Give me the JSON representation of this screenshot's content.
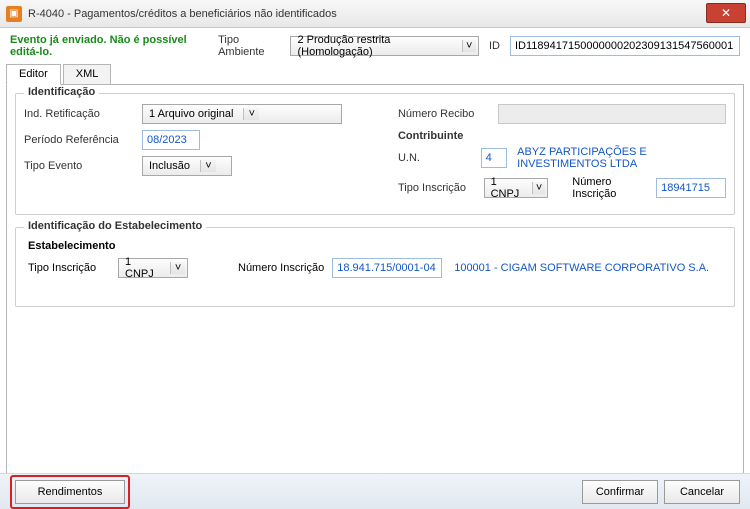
{
  "window": {
    "title": "R-4040 - Pagamentos/créditos a beneficiários não identificados"
  },
  "header": {
    "status": "Evento já enviado. Não é possível editá-lo.",
    "tipo_ambiente_label": "Tipo Ambiente",
    "tipo_ambiente_value": "2 Produção restrita (Homologação)",
    "id_label": "ID",
    "id_value": "ID1189417150000000202309131547560001"
  },
  "tabs": {
    "editor": "Editor",
    "xml": "XML"
  },
  "identificacao": {
    "legend": "Identificação",
    "ind_retificacao_label": "Ind. Retificação",
    "ind_retificacao_value": "1 Arquivo original",
    "periodo_ref_label": "Período Referência",
    "periodo_ref_value": "08/2023",
    "tipo_evento_label": "Tipo Evento",
    "tipo_evento_value": "Inclusão",
    "numero_recibo_label": "Número Recibo",
    "contribuinte_legend": "Contribuinte",
    "un_label": "U.N.",
    "un_value": "4",
    "un_name": "ABYZ PARTICIPAÇÕES E INVESTIMENTOS LTDA",
    "tipo_inscricao_label": "Tipo Inscrição",
    "tipo_inscricao_value": "1 CNPJ",
    "numero_inscricao_label": "Número Inscrição",
    "numero_inscricao_value": "18941715"
  },
  "estab": {
    "legend": "Identificação do Estabelecimento",
    "sub_legend": "Estabelecimento",
    "tipo_inscricao_label": "Tipo Inscrição",
    "tipo_inscricao_value": "1 CNPJ",
    "numero_inscricao_label": "Número Inscrição",
    "numero_inscricao_value": "18.941.715/0001-04",
    "nome": "100001 - CIGAM SOFTWARE CORPORATIVO S.A."
  },
  "footer": {
    "rendimentos": "Rendimentos",
    "confirmar": "Confirmar",
    "cancelar": "Cancelar"
  }
}
